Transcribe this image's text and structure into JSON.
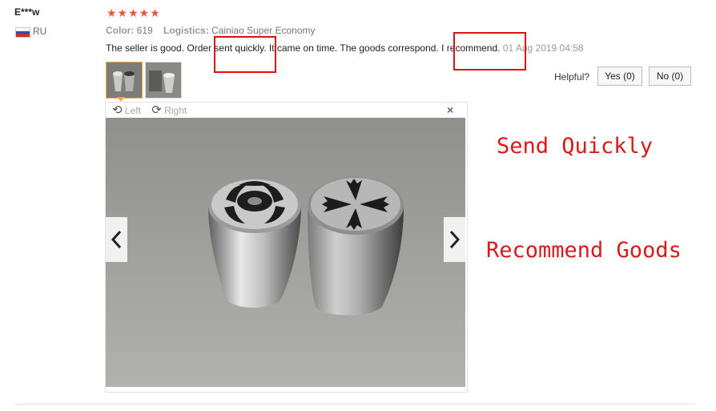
{
  "review": {
    "username": "E***w",
    "country_code": "RU",
    "stars": "★★★★★",
    "color_label": "Color:",
    "color_value": "619",
    "logistics_label": "Logistics:",
    "logistics_value": "Cainiao Super Economy",
    "text_parts": [
      "The seller is good. Order ",
      "sent quickly.",
      " It came on time. The goods correspond. ",
      "I recommend.",
      " "
    ],
    "date": "01 Aug 2019 04:58",
    "helpful_label": "Helpful?",
    "yes_label": "Yes (0)",
    "no_label": "No (0)"
  },
  "viewer": {
    "rotate_left": "Left",
    "rotate_right": "Right",
    "close": "×"
  },
  "annotations": {
    "send_quickly": "Send Quickly",
    "recommend_goods": "Recommend Goods"
  },
  "colors": {
    "stars": "#f0513d",
    "highlight_box": "#dd1111",
    "annotation_text": "#d81a1a",
    "active_thumb_border": "#f6a54a"
  }
}
